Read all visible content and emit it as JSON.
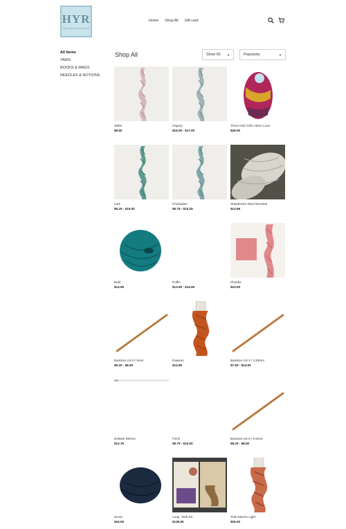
{
  "header": {
    "logo_text": "HYR",
    "logo_sub": "HEATHER YARN ROOM",
    "nav": [
      "Home",
      "Shop All",
      "Gift card"
    ]
  },
  "sidebar": {
    "items": [
      "All Items",
      "YARN",
      "BOOKS & MAGS",
      "NEEDLES & NOTIONS"
    ]
  },
  "main": {
    "title": "Shop All",
    "show_select": "Show 60",
    "sort_select": "Popularity"
  },
  "products": [
    {
      "name": "Willet",
      "price": "$8.50",
      "thumb": "skein",
      "color": "#d7b9bd",
      "shade": "#b99498"
    },
    {
      "name": "Osprey",
      "price": "$16.00 - $17.00",
      "thumb": "skein",
      "color": "#9fb3b6",
      "shade": "#7e9396"
    },
    {
      "name": "Three Irish Girls Adorn Luxe",
      "price": "$28.00",
      "thumb": "multi",
      "color": "#b0265a",
      "shade": "#d9a42a"
    },
    {
      "name": "Lark",
      "price": "$9.25 - $10.00",
      "thumb": "skein",
      "color": "#5e9a90",
      "shade": "#427a71"
    },
    {
      "name": "Chickadee",
      "price": "$9.75 - $10.25",
      "thumb": "skein",
      "color": "#7fa7ab",
      "shade": "#5f878c"
    },
    {
      "name": "Shepherd's Wool Worsted",
      "price": "$13.95",
      "thumb": "wool",
      "color": "#d8d6cc",
      "shade": "#a8a69c"
    },
    {
      "name": "Bold",
      "price": "$14.95",
      "thumb": "ball",
      "color": "#147b80",
      "shade": "#0b5a5e"
    },
    {
      "name": "Puffin",
      "price": "$13.50 - $14.50",
      "thumb": "blank",
      "color": "#ffffff",
      "shade": "#ffffff"
    },
    {
      "name": "Phoebe",
      "price": "$23.00",
      "thumb": "swatch",
      "color": "#e0898b",
      "shade": "#c96b6e"
    },
    {
      "name": "Bamboo US 8 / 5mm",
      "price": "$6.20 - $8.50",
      "thumb": "needle",
      "color": "#c78d55",
      "shade": "#9c6a3a"
    },
    {
      "name": "Dawson",
      "price": "$14.95",
      "thumb": "tagged",
      "color": "#c2541f",
      "shade": "#9a3d12"
    },
    {
      "name": "Bamboo US 3 / 3.25mm",
      "price": "$7.60 - $24.00",
      "thumb": "needle",
      "color": "#c78d55",
      "shade": "#9c6a3a"
    },
    {
      "name": "Delaine Merino",
      "price": "$12.75",
      "thumb": "strip",
      "color": "#e8e8e8",
      "shade": "#bbbbbb"
    },
    {
      "name": "Finch",
      "price": "$9.75 - $10.00",
      "thumb": "blank",
      "color": "#ffffff",
      "shade": "#ffffff"
    },
    {
      "name": "Bamboo US 9 / 5.5mm",
      "price": "$8.20 - $8.50",
      "thumb": "needle",
      "color": "#c78d55",
      "shade": "#9c6a3a"
    },
    {
      "name": "Scout",
      "price": "$16.00",
      "thumb": "ball-dark",
      "color": "#1c2a40",
      "shade": "#0e1726"
    },
    {
      "name": "Loop, Tosh Kit",
      "price": "$135.00",
      "thumb": "kit",
      "color": "#d9c9a8",
      "shade": "#8f6a3f"
    },
    {
      "name": "Tosh Merino Light",
      "price": "$26.00",
      "thumb": "tagged",
      "color": "#c96a4a",
      "shade": "#8e3f2a"
    }
  ]
}
